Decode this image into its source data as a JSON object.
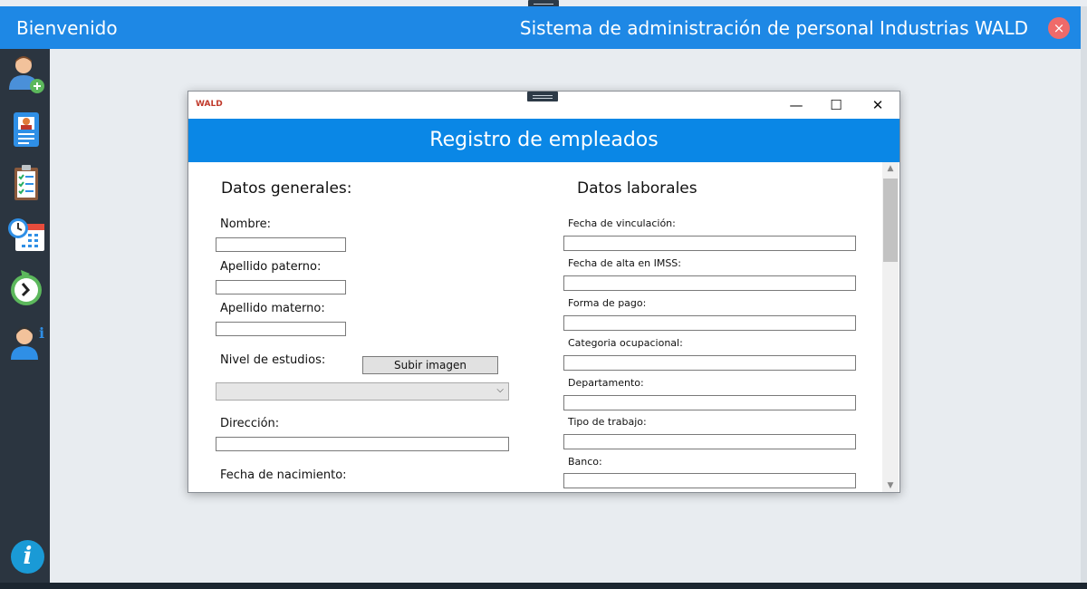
{
  "app": {
    "title_left": "Bienvenido",
    "title_right": "Sistema de administración de personal Industrias WALD",
    "close_icon": "×"
  },
  "sidebar": {
    "items": [
      {
        "icon": "add-user-icon"
      },
      {
        "icon": "employee-card-icon"
      },
      {
        "icon": "clipboard-checklist-icon"
      },
      {
        "icon": "calendar-clock-icon"
      },
      {
        "icon": "refresh-clock-icon"
      },
      {
        "icon": "user-info-icon"
      }
    ],
    "bottom_icon": "info-icon",
    "info_glyph": "i"
  },
  "dialog": {
    "logo_text": "WALD",
    "minimize": "—",
    "maximize": "☐",
    "close": "✕",
    "header": "Registro de empleados",
    "general": {
      "title": "Datos generales:",
      "nombre": "Nombre:",
      "apellido_paterno": "Apellido paterno:",
      "apellido_materno": "Apellido materno:",
      "nivel_estudios": "Nivel de estudios:",
      "upload_button": "Subir imagen",
      "direccion": "Dirección:",
      "fecha_nacimiento": "Fecha de nacimiento:"
    },
    "laboral": {
      "title": "Datos laborales",
      "fecha_vinculacion": "Fecha de vinculación:",
      "fecha_alta_imss": "Fecha de alta en IMSS:",
      "forma_pago": "Forma de pago:",
      "categoria": "Categoria ocupacional:",
      "departamento": "Departamento:",
      "tipo_trabajo": "Tipo de trabajo:",
      "banco": "Banco:"
    }
  },
  "colors": {
    "header_blue": "#1e88e5",
    "dialog_header_blue": "#0a87e6",
    "sidebar": "#2b3540",
    "content_bg": "#e8ecf0",
    "close_red": "#ef6a6a"
  }
}
